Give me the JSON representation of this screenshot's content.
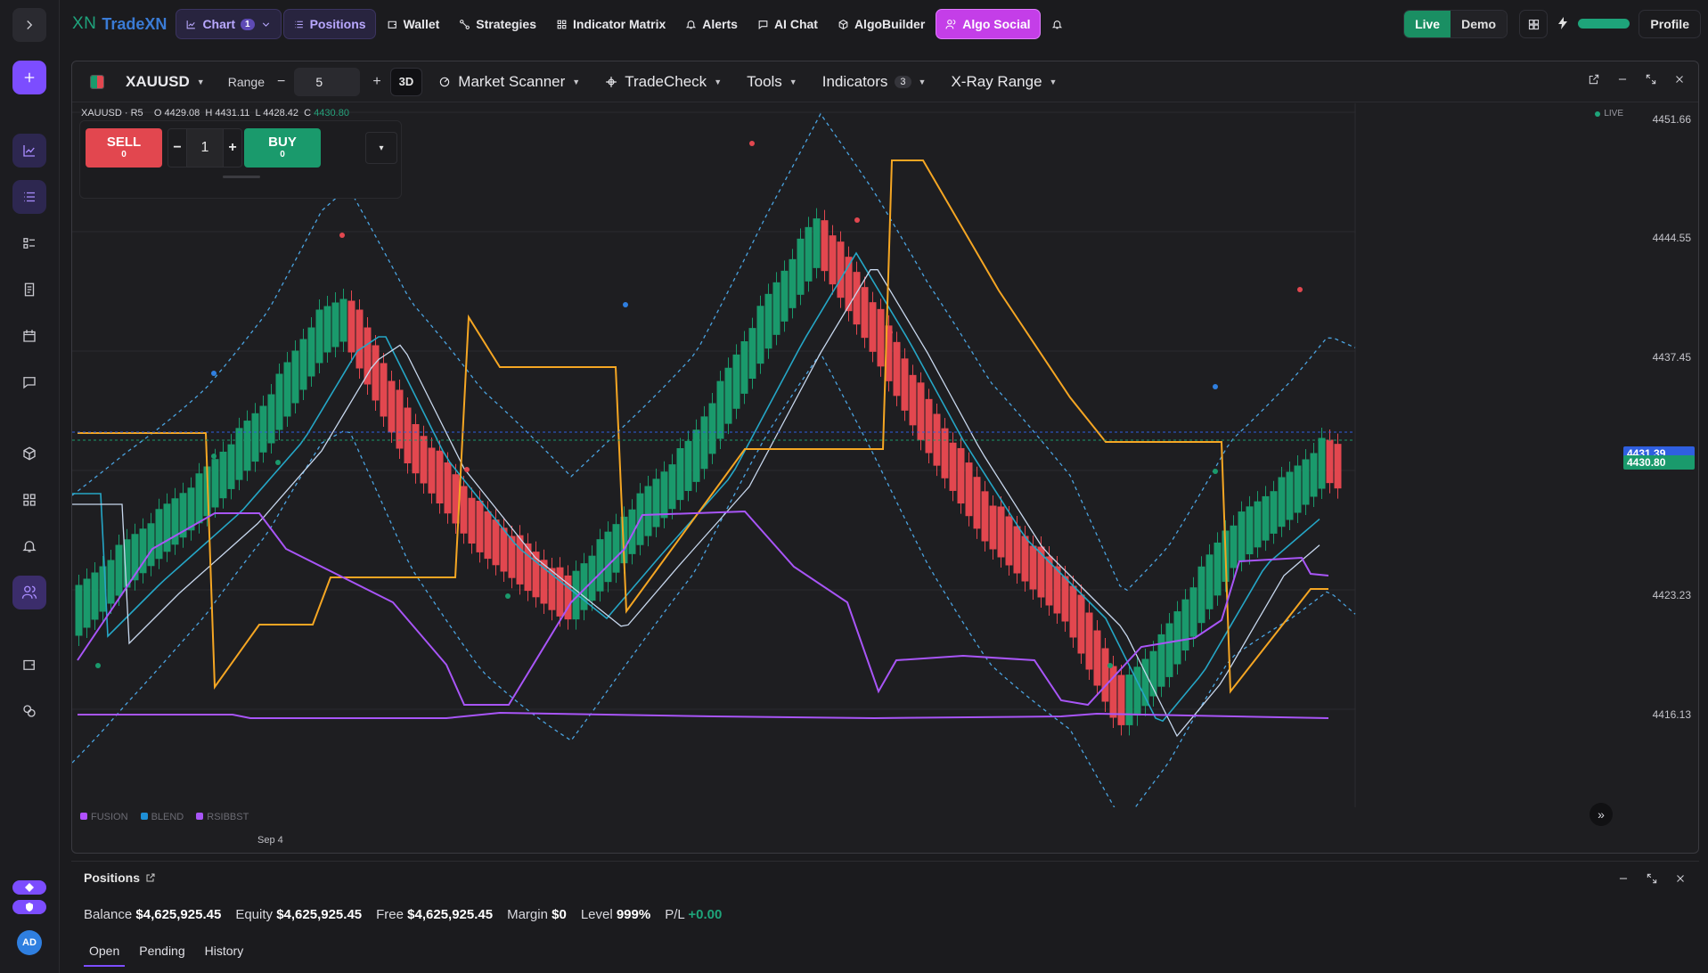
{
  "brand": {
    "logo": "XN",
    "name": "TradeXN"
  },
  "nav": {
    "chart": "Chart",
    "chart_badge": "1",
    "positions": "Positions",
    "wallet": "Wallet",
    "strategies": "Strategies",
    "indicator_matrix": "Indicator Matrix",
    "alerts": "Alerts",
    "ai_chat": "AI Chat",
    "algobuilder": "AlgoBuilder",
    "algo_social": "Algo Social"
  },
  "account_mode": {
    "live": "Live",
    "demo": "Demo",
    "selected": "Live"
  },
  "profile": "Profile",
  "top_progress": 1.0,
  "toolbar": {
    "symbol": "XAUUSD",
    "range_label": "Range",
    "range_value": "5",
    "minus": "−",
    "plus": "+",
    "three_d": "3D",
    "market_scanner": "Market Scanner",
    "tradecheck": "TradeCheck",
    "tools": "Tools",
    "indicators": "Indicators",
    "indicators_count": "3",
    "xray": "X-Ray Range"
  },
  "ohlc": {
    "symbol": "XAUUSD · R5",
    "open": "O 4429.08",
    "high": "H 4431.11",
    "low": "L 4428.42",
    "close_label": "C",
    "close": "4430.80"
  },
  "live_tag": "LIVE",
  "trade": {
    "sell_label": "SELL",
    "sell_value": "0",
    "buy_label": "BUY",
    "buy_value": "0",
    "quantity": "1",
    "minus": "−",
    "plus": "+",
    "caret": "▾"
  },
  "price_axis": {
    "ticks": [
      "4451.66",
      "4444.55",
      "4437.45",
      "4430.34",
      "4423.23",
      "4416.13"
    ],
    "blue_tag": "4431.39",
    "green_tag": "4430.80"
  },
  "legend": [
    {
      "name": "FUSION",
      "color": "#b050ff"
    },
    {
      "name": "BLEND",
      "color": "#1e8fd6"
    },
    {
      "name": "RSIBBST",
      "color": "#a855f7"
    }
  ],
  "x_axis": {
    "label": "Sep 4"
  },
  "colors": {
    "up": "#1a9a6c",
    "down": "#e2474f",
    "accent": "#7c4dff",
    "band": "#4aa3e0",
    "orange": "#f5a623",
    "purple": "#a855f7"
  },
  "positions": {
    "title": "Positions",
    "balance_label": "Balance",
    "balance": "$4,625,925.45",
    "equity_label": "Equity",
    "equity": "$4,625,925.45",
    "free_label": "Free",
    "free": "$4,625,925.45",
    "margin_label": "Margin",
    "margin": "$0",
    "level_label": "Level",
    "level": "999%",
    "pl_label": "P/L",
    "pl": "+0.00",
    "tabs": [
      "Open",
      "Pending",
      "History"
    ],
    "active_tab": "Open"
  },
  "user_initials": "AD"
}
